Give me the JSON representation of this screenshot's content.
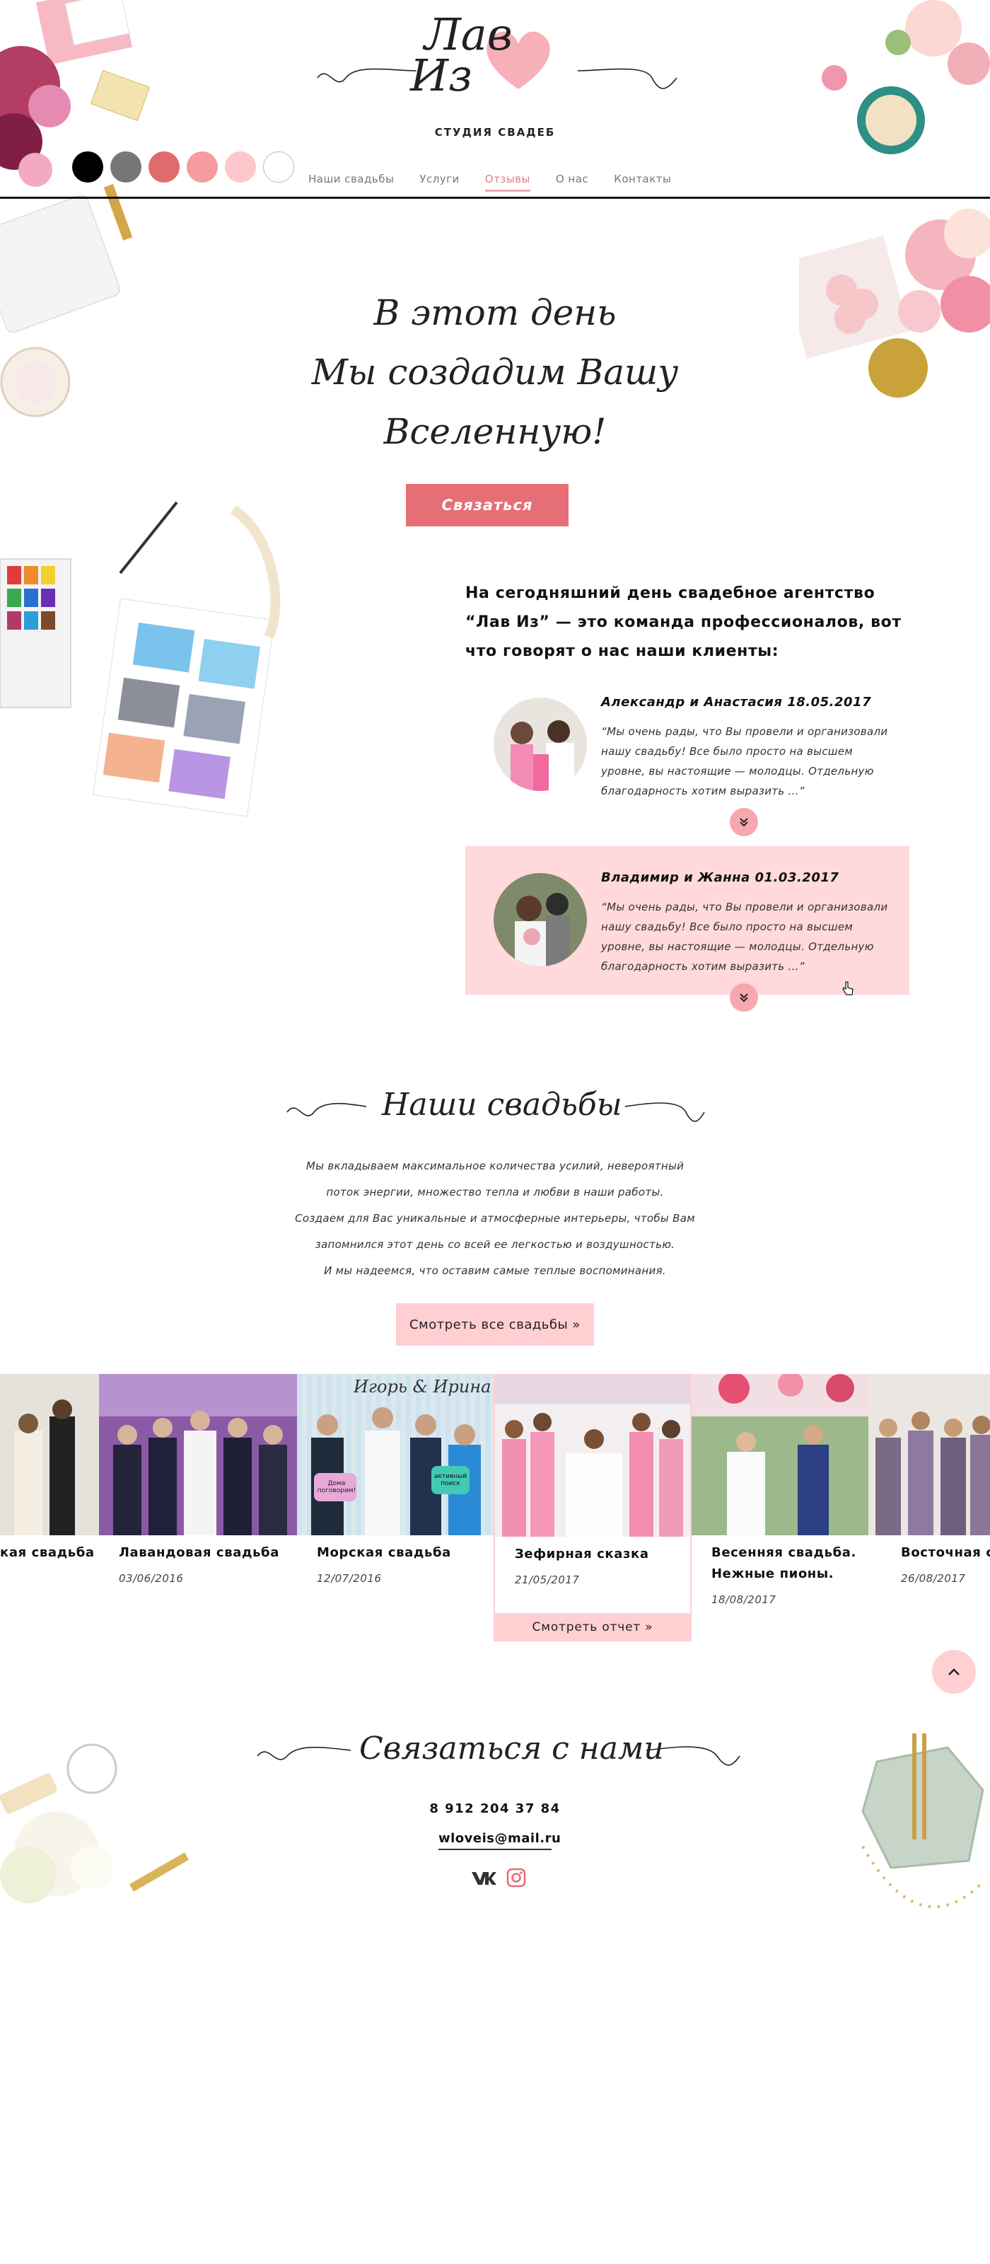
{
  "brand": {
    "logo_line1": "Лав",
    "logo_line2": "Из",
    "subtitle": "СТУДИЯ СВАДЕБ"
  },
  "palette": [
    "#000000",
    "#777777",
    "#e06a6c",
    "#f59ba1",
    "#ffc6cc",
    "#ffffff"
  ],
  "nav": {
    "items": [
      "Наши свадьбы",
      "Услуги",
      "Отзывы",
      "О нас",
      "Контакты"
    ],
    "active_index": 2
  },
  "hero": {
    "line1": "В этот день",
    "line2": "Мы создадим Вашу",
    "line3": "Вселенную!",
    "cta": "Связаться"
  },
  "reviews": {
    "intro": "На сегодняшний день свадебное агентство “Лав Из” — это команда профессионалов, вот что говорят о нас наши клиенты:",
    "items": [
      {
        "name": "Александр и Анастасия 18.05.2017",
        "text": "“Мы очень рады, что Вы провели и организовали нашу свадьбу! Все было просто на высшем уровне, вы настоящие — молодцы. Отдельную благодарность хотим выразить ...”"
      },
      {
        "name": "Владимир и Жанна 01.03.2017",
        "text": "“Мы очень рады, что Вы провели и организовали нашу свадьбу! Все было просто на высшем уровне, вы настоящие — молодцы. Отдельную благодарность хотим выразить ...”"
      }
    ]
  },
  "weddings": {
    "title": "Наши свадьбы",
    "text": [
      "Мы вкладываем максимальное количества усилий, невероятный",
      "поток энергии, множество тепла и любви в наши работы.",
      "Создаем для Вас уникальные и атмосферные интерьеры, чтобы Вам",
      "запомнился этот день со всей ее легкостью и воздушностью.",
      "И мы надеемся, что оставим самые теплые воспоминания."
    ],
    "button": "Смотреть все свадьбы »",
    "cards": [
      {
        "title": "кая свадьба",
        "date": ""
      },
      {
        "title": "Лавандовая свадьба",
        "date": "03/06/2016"
      },
      {
        "title": "Морская свадьба",
        "date": "12/07/2016",
        "sign": "Игорь & Ирина",
        "bubble1": "Дома поговорим!",
        "bubble2": "активный поиск"
      },
      {
        "title": "Зефирная сказка",
        "date": "21/05/2017",
        "report": "Смотреть отчет »"
      },
      {
        "title": "Весенняя свадьба. Нежные пионы.",
        "date": "18/08/2017"
      },
      {
        "title": "Восточная с",
        "date": "26/08/2017"
      }
    ]
  },
  "contacts": {
    "title": "Связаться с нами",
    "phone": "8 912 204 37 84",
    "email": "wloveis@mail.ru"
  },
  "icons": {
    "vk": "vk-icon",
    "instagram": "instagram-icon",
    "to_top": "chevron-up-icon",
    "more": "double-chevron-down-icon"
  }
}
